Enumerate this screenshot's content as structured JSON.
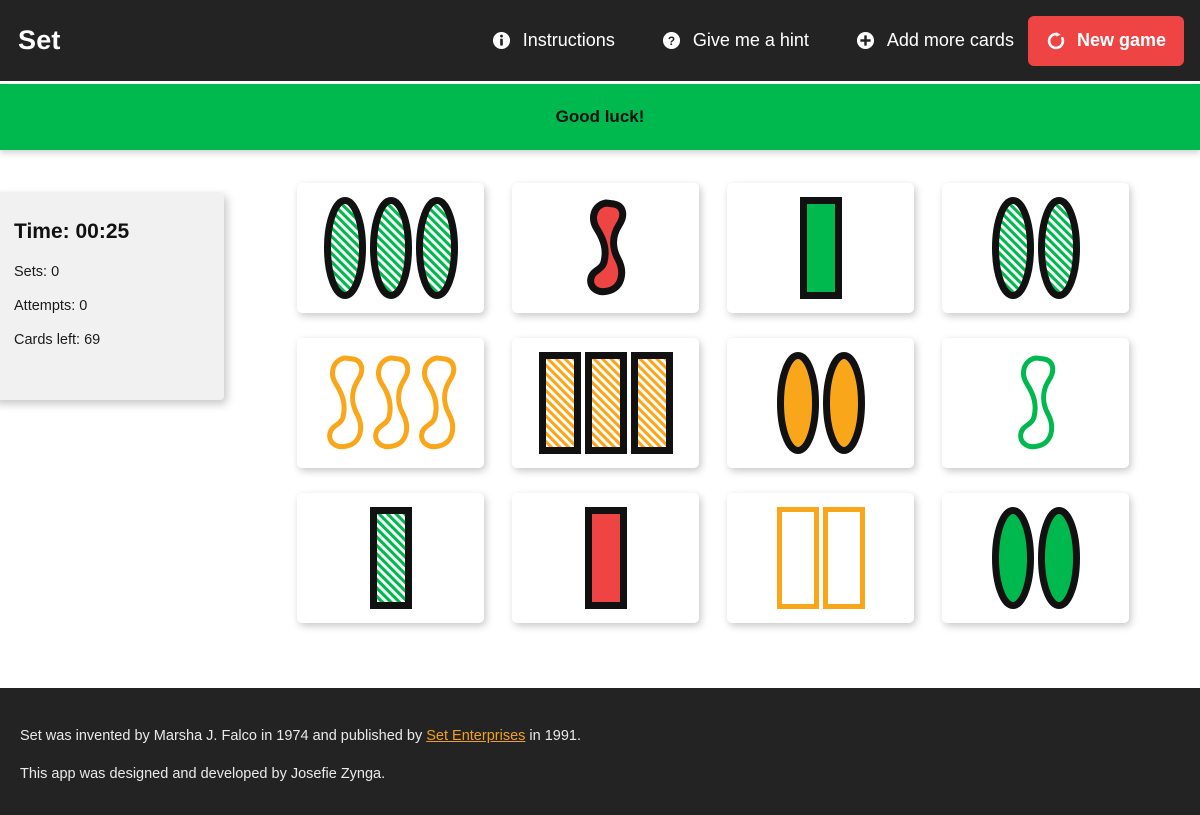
{
  "header": {
    "brand": "Set",
    "nav": [
      {
        "label": "Instructions",
        "icon": "info-icon",
        "name": "instructions"
      },
      {
        "label": "Give me a hint",
        "icon": "question-icon",
        "name": "hint"
      },
      {
        "label": "Add more cards",
        "icon": "plus-icon",
        "name": "add-more-cards"
      }
    ],
    "new_game_label": "New game",
    "new_game_icon": "refresh-icon"
  },
  "banner": {
    "message": "Good luck!"
  },
  "stats": {
    "time_label": "Time: 00:25",
    "sets_label": "Sets: 0",
    "attempts_label": "Attempts: 0",
    "cards_left_label": "Cards left: 69"
  },
  "colors": {
    "green": "#00b94e",
    "red": "#ee4444",
    "orange": "#f9a61a",
    "dark": "#232323",
    "card_bg": "#ffffff",
    "panel_bg": "#f1f1f1",
    "link": "#f0a020"
  },
  "board": {
    "rows": 3,
    "columns": 4,
    "cards": [
      {
        "count": 3,
        "shape": "ellipse",
        "color": "green",
        "shading": "striped"
      },
      {
        "count": 1,
        "shape": "squiggle",
        "color": "red",
        "shading": "solid"
      },
      {
        "count": 1,
        "shape": "rectangle",
        "color": "green",
        "shading": "solid"
      },
      {
        "count": 2,
        "shape": "ellipse",
        "color": "green",
        "shading": "striped"
      },
      {
        "count": 3,
        "shape": "squiggle",
        "color": "orange",
        "shading": "open"
      },
      {
        "count": 3,
        "shape": "rectangle",
        "color": "orange",
        "shading": "striped"
      },
      {
        "count": 2,
        "shape": "ellipse",
        "color": "orange",
        "shading": "solid"
      },
      {
        "count": 1,
        "shape": "squiggle",
        "color": "green",
        "shading": "open"
      },
      {
        "count": 1,
        "shape": "rectangle",
        "color": "green",
        "shading": "striped"
      },
      {
        "count": 1,
        "shape": "rectangle",
        "color": "red",
        "shading": "solid"
      },
      {
        "count": 2,
        "shape": "rectangle",
        "color": "orange",
        "shading": "open"
      },
      {
        "count": 2,
        "shape": "ellipse",
        "color": "green",
        "shading": "solid"
      }
    ]
  },
  "footer": {
    "line1_before": "Set was invented by Marsha J. Falco in 1974 and published by ",
    "line1_link": "Set Enterprises",
    "line1_after": " in 1991.",
    "line2": "This app was designed and developed by Josefie Zynga."
  }
}
